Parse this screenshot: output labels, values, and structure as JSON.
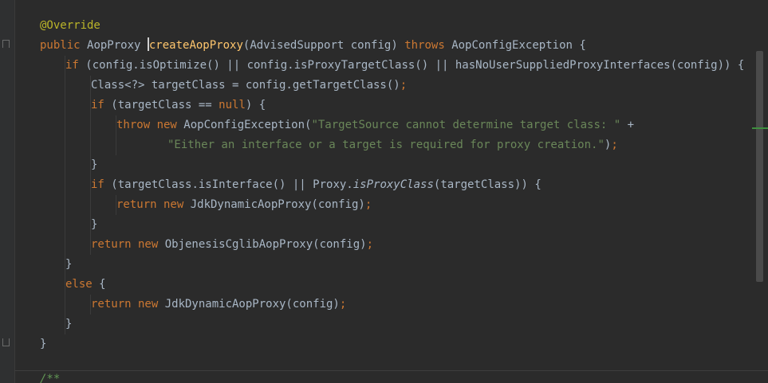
{
  "editor": {
    "lines": [
      {
        "indent": 0,
        "tokens": [
          {
            "t": "@Override",
            "c": "ann"
          }
        ]
      },
      {
        "indent": 0,
        "tokens": [
          {
            "t": "public ",
            "c": "kw"
          },
          {
            "t": "AopProxy "
          },
          {
            "caret": true
          },
          {
            "t": "createAopProxy",
            "c": "m"
          },
          {
            "t": "(AdvisedSupport config) "
          },
          {
            "t": "throws ",
            "c": "kw"
          },
          {
            "t": "AopConfigException {"
          }
        ]
      },
      {
        "indent": 1,
        "tokens": [
          {
            "t": "if ",
            "c": "kw"
          },
          {
            "t": "(config.isOptimize() || config.isProxyTargetClass() || hasNoUserSuppliedProxyInterfaces(config)) {"
          }
        ]
      },
      {
        "indent": 2,
        "tokens": [
          {
            "t": "Class<?> targetClass = config.getTargetClass()"
          },
          {
            "t": ";",
            "c": "punct"
          }
        ]
      },
      {
        "indent": 2,
        "tokens": [
          {
            "t": "if ",
            "c": "kw"
          },
          {
            "t": "(targetClass == "
          },
          {
            "t": "null",
            "c": "kw"
          },
          {
            "t": ") {"
          }
        ]
      },
      {
        "indent": 3,
        "tokens": [
          {
            "t": "throw new ",
            "c": "kw"
          },
          {
            "t": "AopConfigException("
          },
          {
            "t": "\"TargetSource cannot determine target class: \"",
            "c": "str"
          },
          {
            "t": " +"
          }
        ]
      },
      {
        "indent": 5,
        "tokens": [
          {
            "t": "\"Either an interface or a target is required for proxy creation.\"",
            "c": "str"
          },
          {
            "t": ")"
          },
          {
            "t": ";",
            "c": "punct"
          }
        ]
      },
      {
        "indent": 2,
        "tokens": [
          {
            "t": "}"
          }
        ]
      },
      {
        "indent": 2,
        "tokens": [
          {
            "t": "if ",
            "c": "kw"
          },
          {
            "t": "(targetClass.isInterface() || Proxy."
          },
          {
            "t": "isProxyClass",
            "c": "it"
          },
          {
            "t": "(targetClass)) {"
          }
        ]
      },
      {
        "indent": 3,
        "tokens": [
          {
            "t": "return new ",
            "c": "kw"
          },
          {
            "t": "JdkDynamicAopProxy(config)"
          },
          {
            "t": ";",
            "c": "punct"
          }
        ]
      },
      {
        "indent": 2,
        "tokens": [
          {
            "t": "}"
          }
        ]
      },
      {
        "indent": 2,
        "tokens": [
          {
            "t": "return new ",
            "c": "kw"
          },
          {
            "t": "ObjenesisCglibAopProxy(config)"
          },
          {
            "t": ";",
            "c": "punct"
          }
        ]
      },
      {
        "indent": 1,
        "tokens": [
          {
            "t": "}"
          }
        ]
      },
      {
        "indent": 1,
        "tokens": [
          {
            "t": "else ",
            "c": "kw"
          },
          {
            "t": "{"
          }
        ]
      },
      {
        "indent": 2,
        "tokens": [
          {
            "t": "return new ",
            "c": "kw"
          },
          {
            "t": "JdkDynamicAopProxy(config)"
          },
          {
            "t": ";",
            "c": "punct"
          }
        ]
      },
      {
        "indent": 1,
        "tokens": [
          {
            "t": "}"
          }
        ]
      },
      {
        "indent": 0,
        "tokens": [
          {
            "t": "}"
          }
        ]
      }
    ],
    "trailing_comment": "/**"
  },
  "colors": {
    "background": "#2b2b2b",
    "keyword": "#cc7832",
    "method": "#ffc66d",
    "string": "#6a8759",
    "annotation": "#bbb529",
    "text": "#a9b7c6"
  },
  "icons": [
    "fold-open-icon",
    "fold-close-icon"
  ]
}
